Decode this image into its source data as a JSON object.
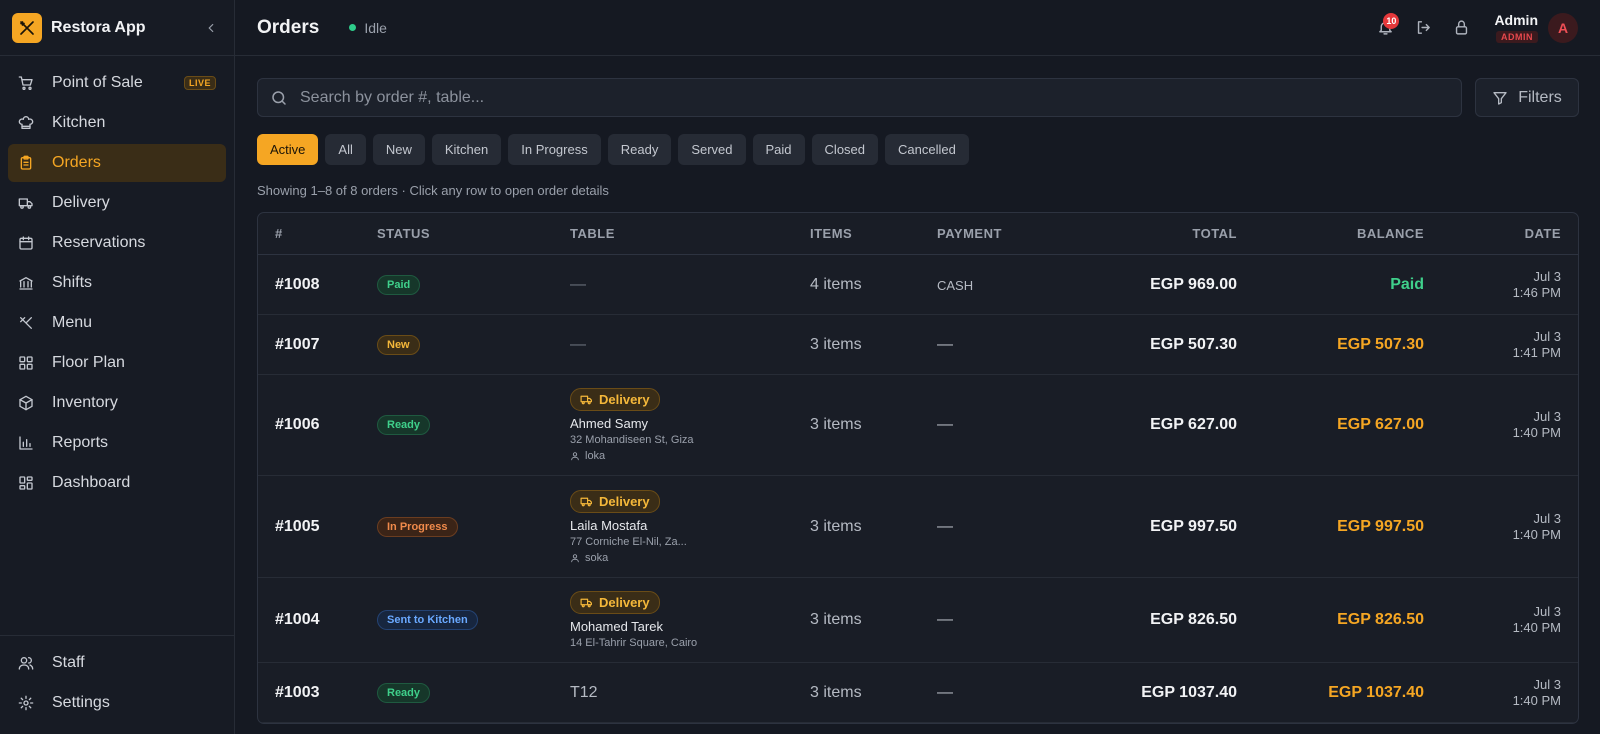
{
  "app": {
    "name": "Restora App"
  },
  "sidebar": {
    "items": [
      {
        "label": "Point of Sale",
        "icon": "cart-icon",
        "badge": "LIVE"
      },
      {
        "label": "Kitchen",
        "icon": "chef-hat-icon"
      },
      {
        "label": "Orders",
        "icon": "clipboard-icon",
        "active": true
      },
      {
        "label": "Delivery",
        "icon": "truck-icon"
      },
      {
        "label": "Reservations",
        "icon": "calendar-icon"
      },
      {
        "label": "Shifts",
        "icon": "bank-icon"
      },
      {
        "label": "Menu",
        "icon": "utensils-icon"
      },
      {
        "label": "Floor Plan",
        "icon": "grid-icon"
      },
      {
        "label": "Inventory",
        "icon": "package-icon"
      },
      {
        "label": "Reports",
        "icon": "bar-chart-icon"
      },
      {
        "label": "Dashboard",
        "icon": "dashboard-icon"
      }
    ],
    "bottom": [
      {
        "label": "Staff",
        "icon": "users-icon"
      },
      {
        "label": "Settings",
        "icon": "gear-icon"
      }
    ]
  },
  "header": {
    "title": "Orders",
    "status": "Idle",
    "notifications": "10",
    "user_name": "Admin",
    "user_role": "ADMIN",
    "avatar_initial": "A"
  },
  "search": {
    "placeholder": "Search by order #, table...",
    "filters_label": "Filters"
  },
  "tabs": [
    "Active",
    "All",
    "New",
    "Kitchen",
    "In Progress",
    "Ready",
    "Served",
    "Paid",
    "Closed",
    "Cancelled"
  ],
  "showing_text": "Showing 1–8 of 8 orders · Click any row to open order details",
  "table": {
    "columns": [
      "#",
      "STATUS",
      "TABLE",
      "ITEMS",
      "PAYMENT",
      "TOTAL",
      "BALANCE",
      "DATE"
    ],
    "rows": [
      {
        "id": "#1008",
        "status": "Paid",
        "table": "—",
        "items": "4 items",
        "payment": "CASH",
        "total": "EGP 969.00",
        "balance": "Paid",
        "date": "Jul 3",
        "time": "1:46 PM"
      },
      {
        "id": "#1007",
        "status": "New",
        "table": "—",
        "items": "3 items",
        "payment": "—",
        "total": "EGP 507.30",
        "balance": "EGP 507.30",
        "date": "Jul 3",
        "time": "1:41 PM"
      },
      {
        "id": "#1006",
        "status": "Ready",
        "delivery": "Delivery",
        "customer": "Ahmed Samy",
        "address": "32 Mohandiseen St, Giza",
        "driver": "loka",
        "items": "3 items",
        "payment": "—",
        "total": "EGP 627.00",
        "balance": "EGP 627.00",
        "date": "Jul 3",
        "time": "1:40 PM"
      },
      {
        "id": "#1005",
        "status": "In Progress",
        "delivery": "Delivery",
        "customer": "Laila Mostafa",
        "address": "77 Corniche El-Nil, Za...",
        "driver": "soka",
        "items": "3 items",
        "payment": "—",
        "total": "EGP 997.50",
        "balance": "EGP 997.50",
        "date": "Jul 3",
        "time": "1:40 PM"
      },
      {
        "id": "#1004",
        "status": "Sent to Kitchen",
        "delivery": "Delivery",
        "customer": "Mohamed Tarek",
        "address": "14 El-Tahrir Square, Cairo",
        "items": "3 items",
        "payment": "—",
        "total": "EGP 826.50",
        "balance": "EGP 826.50",
        "date": "Jul 3",
        "time": "1:40 PM"
      },
      {
        "id": "#1003",
        "status": "Ready",
        "table": "T12",
        "items": "3 items",
        "payment": "—",
        "total": "EGP 1037.40",
        "balance": "EGP 1037.40",
        "date": "Jul 3",
        "time": "1:40 PM"
      }
    ]
  },
  "colors": {
    "accent": "#f5a623",
    "success": "#3fd08b",
    "danger": "#e5484d",
    "background": "#151922"
  }
}
